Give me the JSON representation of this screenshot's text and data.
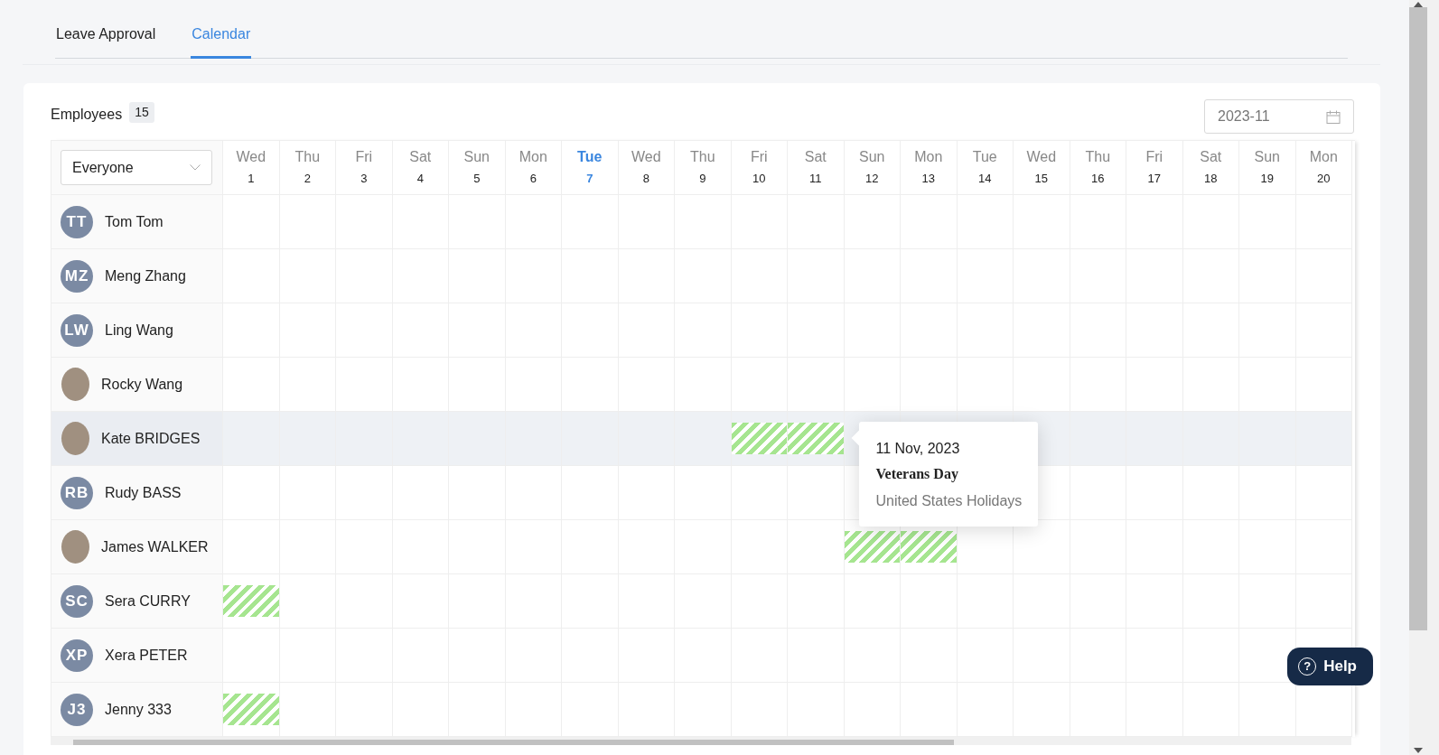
{
  "tabs": [
    {
      "label": "Leave Approval",
      "selected": false
    },
    {
      "label": "Calendar",
      "selected": true
    }
  ],
  "employees_title": "Employees",
  "employees_count": "15",
  "month_picker": {
    "value": "2023-11"
  },
  "filter": {
    "value": "Everyone"
  },
  "days": [
    {
      "weekday": "Wed",
      "date": "1",
      "today": false
    },
    {
      "weekday": "Thu",
      "date": "2",
      "today": false
    },
    {
      "weekday": "Fri",
      "date": "3",
      "today": false
    },
    {
      "weekday": "Sat",
      "date": "4",
      "today": false
    },
    {
      "weekday": "Sun",
      "date": "5",
      "today": false
    },
    {
      "weekday": "Mon",
      "date": "6",
      "today": false
    },
    {
      "weekday": "Tue",
      "date": "7",
      "today": true
    },
    {
      "weekday": "Wed",
      "date": "8",
      "today": false
    },
    {
      "weekday": "Thu",
      "date": "9",
      "today": false
    },
    {
      "weekday": "Fri",
      "date": "10",
      "today": false
    },
    {
      "weekday": "Sat",
      "date": "11",
      "today": false
    },
    {
      "weekday": "Sun",
      "date": "12",
      "today": false
    },
    {
      "weekday": "Mon",
      "date": "13",
      "today": false
    },
    {
      "weekday": "Tue",
      "date": "14",
      "today": false
    },
    {
      "weekday": "Wed",
      "date": "15",
      "today": false
    },
    {
      "weekday": "Thu",
      "date": "16",
      "today": false
    },
    {
      "weekday": "Fri",
      "date": "17",
      "today": false
    },
    {
      "weekday": "Sat",
      "date": "18",
      "today": false
    },
    {
      "weekday": "Sun",
      "date": "19",
      "today": false
    },
    {
      "weekday": "Mon",
      "date": "20",
      "today": false
    }
  ],
  "employees": [
    {
      "name": "Tom Tom",
      "avatar": {
        "kind": "initials",
        "initials": "TT"
      },
      "hovered": false,
      "leave": [
        false,
        false,
        false,
        false,
        false,
        false,
        false,
        false,
        false,
        false,
        false,
        false,
        false,
        false,
        false,
        false,
        false,
        false,
        false,
        false
      ]
    },
    {
      "name": "Meng Zhang",
      "avatar": {
        "kind": "initials",
        "initials": "MZ"
      },
      "hovered": false,
      "leave": [
        false,
        false,
        false,
        false,
        false,
        false,
        false,
        false,
        false,
        false,
        false,
        false,
        false,
        false,
        false,
        false,
        false,
        false,
        false,
        false
      ]
    },
    {
      "name": "Ling Wang",
      "avatar": {
        "kind": "initials",
        "initials": "LW"
      },
      "hovered": false,
      "leave": [
        false,
        false,
        false,
        false,
        false,
        false,
        false,
        false,
        false,
        false,
        false,
        false,
        false,
        false,
        false,
        false,
        false,
        false,
        false,
        false
      ]
    },
    {
      "name": "Rocky Wang",
      "avatar": {
        "kind": "photo"
      },
      "hovered": false,
      "leave": [
        false,
        false,
        false,
        false,
        false,
        false,
        false,
        false,
        false,
        false,
        false,
        false,
        false,
        false,
        false,
        false,
        false,
        false,
        false,
        false
      ]
    },
    {
      "name": "Kate BRIDGES",
      "avatar": {
        "kind": "photo"
      },
      "hovered": true,
      "leave": [
        false,
        false,
        false,
        false,
        false,
        false,
        false,
        false,
        false,
        true,
        true,
        false,
        false,
        false,
        false,
        false,
        false,
        false,
        false,
        false
      ],
      "tooltip": {
        "date": "11 Nov, 2023",
        "title": "Veterans Day",
        "calendar": "United States Holidays"
      }
    },
    {
      "name": "Rudy BASS",
      "avatar": {
        "kind": "initials",
        "initials": "RB"
      },
      "hovered": false,
      "leave": [
        false,
        false,
        false,
        false,
        false,
        false,
        false,
        false,
        false,
        false,
        false,
        false,
        false,
        false,
        false,
        false,
        false,
        false,
        false,
        false
      ]
    },
    {
      "name": "James WALKER",
      "avatar": {
        "kind": "photo"
      },
      "hovered": false,
      "leave": [
        false,
        false,
        false,
        false,
        false,
        false,
        false,
        false,
        false,
        false,
        false,
        true,
        true,
        false,
        false,
        false,
        false,
        false,
        false,
        false
      ]
    },
    {
      "name": "Sera CURRY",
      "avatar": {
        "kind": "initials",
        "initials": "SC"
      },
      "hovered": false,
      "leave": [
        true,
        false,
        false,
        false,
        false,
        false,
        false,
        false,
        false,
        false,
        false,
        false,
        false,
        false,
        false,
        false,
        false,
        false,
        false,
        false
      ]
    },
    {
      "name": "Xera PETER",
      "avatar": {
        "kind": "initials",
        "initials": "XP"
      },
      "hovered": false,
      "leave": [
        false,
        false,
        false,
        false,
        false,
        false,
        false,
        false,
        false,
        false,
        false,
        false,
        false,
        false,
        false,
        false,
        false,
        false,
        false,
        false
      ]
    },
    {
      "name": "Jenny 333",
      "avatar": {
        "kind": "initials",
        "initials": "J3"
      },
      "hovered": false,
      "leave": [
        true,
        false,
        false,
        false,
        false,
        false,
        false,
        false,
        false,
        false,
        false,
        false,
        false,
        false,
        false,
        false,
        false,
        false,
        false,
        false
      ]
    }
  ],
  "help_button": {
    "icon": "?",
    "label": "Help"
  }
}
